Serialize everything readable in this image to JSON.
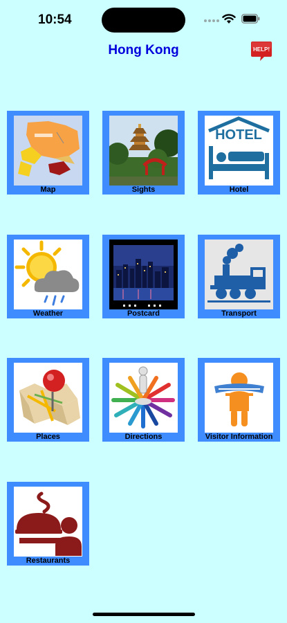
{
  "status_bar": {
    "time": "10:54"
  },
  "header": {
    "title": "Hong Kong",
    "help_label": "HELP!"
  },
  "tiles": [
    {
      "label": "Map",
      "icon": "map-icon"
    },
    {
      "label": "Sights",
      "icon": "pagoda-icon"
    },
    {
      "label": "Hotel",
      "icon": "hotel-bed-icon"
    },
    {
      "label": "Weather",
      "icon": "sun-cloud-icon"
    },
    {
      "label": "Postcard",
      "icon": "skyline-icon"
    },
    {
      "label": "Transport",
      "icon": "train-icon"
    },
    {
      "label": "Places",
      "icon": "map-pin-icon"
    },
    {
      "label": "Directions",
      "icon": "compass-arrows-icon"
    },
    {
      "label": "Visitor Information",
      "icon": "information-person-icon"
    },
    {
      "label": "Restaurants",
      "icon": "waiter-icon"
    }
  ],
  "hotel_sign_text": "HOTEL",
  "colors": {
    "background": "#CCFFFF",
    "tile_border": "#3F8CFF",
    "title": "#0000DD",
    "help_red": "#D32020"
  }
}
